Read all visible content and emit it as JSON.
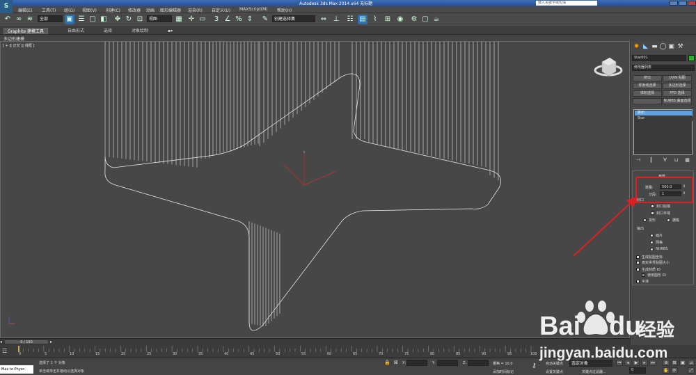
{
  "app": {
    "title": "Autodesk 3ds Max 2014 x64    无标题",
    "search_placeholder": "键入关键字或短语",
    "logo": "S"
  },
  "menu": [
    "编辑(E)",
    "工具(T)",
    "组(G)",
    "视图(V)",
    "创建(C)",
    "修改器",
    "动画",
    "图形编辑器",
    "渲染(R)",
    "自定义(U)",
    "MAXScript(M)",
    "帮助(H)"
  ],
  "toolbar": {
    "selection_filter": "全部",
    "ref_coord": "视图",
    "named_selection": "创建选择集"
  },
  "ribbon": {
    "tabs": [
      "Graphite 建模工具",
      "自由形式",
      "选择",
      "对象绘制"
    ],
    "sub_label": "多边形建模"
  },
  "viewport": {
    "label": "[ + ][ 正交 ][ 线框 ]"
  },
  "command_panel": {
    "object_name": "Star001",
    "color": "#2bb52b",
    "modifier_list": "修改器列表",
    "modifier_buttons": [
      "挤出",
      "UVW 贴图",
      "样条线选择",
      "多边形选择",
      "体积选择",
      "FFD 选择",
      "",
      "NURBS 曲面选择"
    ],
    "stack_items": [
      "挤出",
      "Star"
    ],
    "params": {
      "title": "参数",
      "amount_label": "数量:",
      "amount_value": "500.0",
      "segments_label": "分段:",
      "segments_value": "1",
      "capping_title": "封口",
      "cap_start": "封口始端",
      "cap_end": "封口末端",
      "morph": "变形",
      "grid": "栅格",
      "output_title": "输出",
      "patch": "面片",
      "mesh": "网格",
      "nurbs": "NURBS",
      "gen_map_coords": "生成贴图坐标",
      "real_world_map": "真实世界贴图大小",
      "gen_mat_ids": "生成材质 ID",
      "use_shape_ids": "使用图形 ID",
      "smooth": "平滑"
    }
  },
  "timeline": {
    "frame_display": "0 / 100",
    "ticks": [
      "0",
      "5",
      "10",
      "15",
      "20",
      "25",
      "30",
      "35",
      "40",
      "45",
      "50",
      "55",
      "60",
      "65",
      "70",
      "75",
      "80",
      "85",
      "90",
      "95",
      "100"
    ]
  },
  "status": {
    "maxscript": "Max to Physc",
    "selected": "选择了 1 个 对象",
    "prompt": "单击或单击并拖动以选择对象",
    "x_label": "X:",
    "y_label": "Y:",
    "z_label": "Z:",
    "grid": "栅格 = 10.0",
    "add_time_tag": "添加时间标记",
    "auto_key": "自动关键点",
    "set_key": "设置关键点",
    "selected_obj": "选定对象",
    "key_filters": "关键点过滤器...",
    "frame": "0"
  },
  "watermark": {
    "brand": "Bai",
    "brand2": "du",
    "cn": "经验",
    "url": "jingyan.baidu.com"
  }
}
